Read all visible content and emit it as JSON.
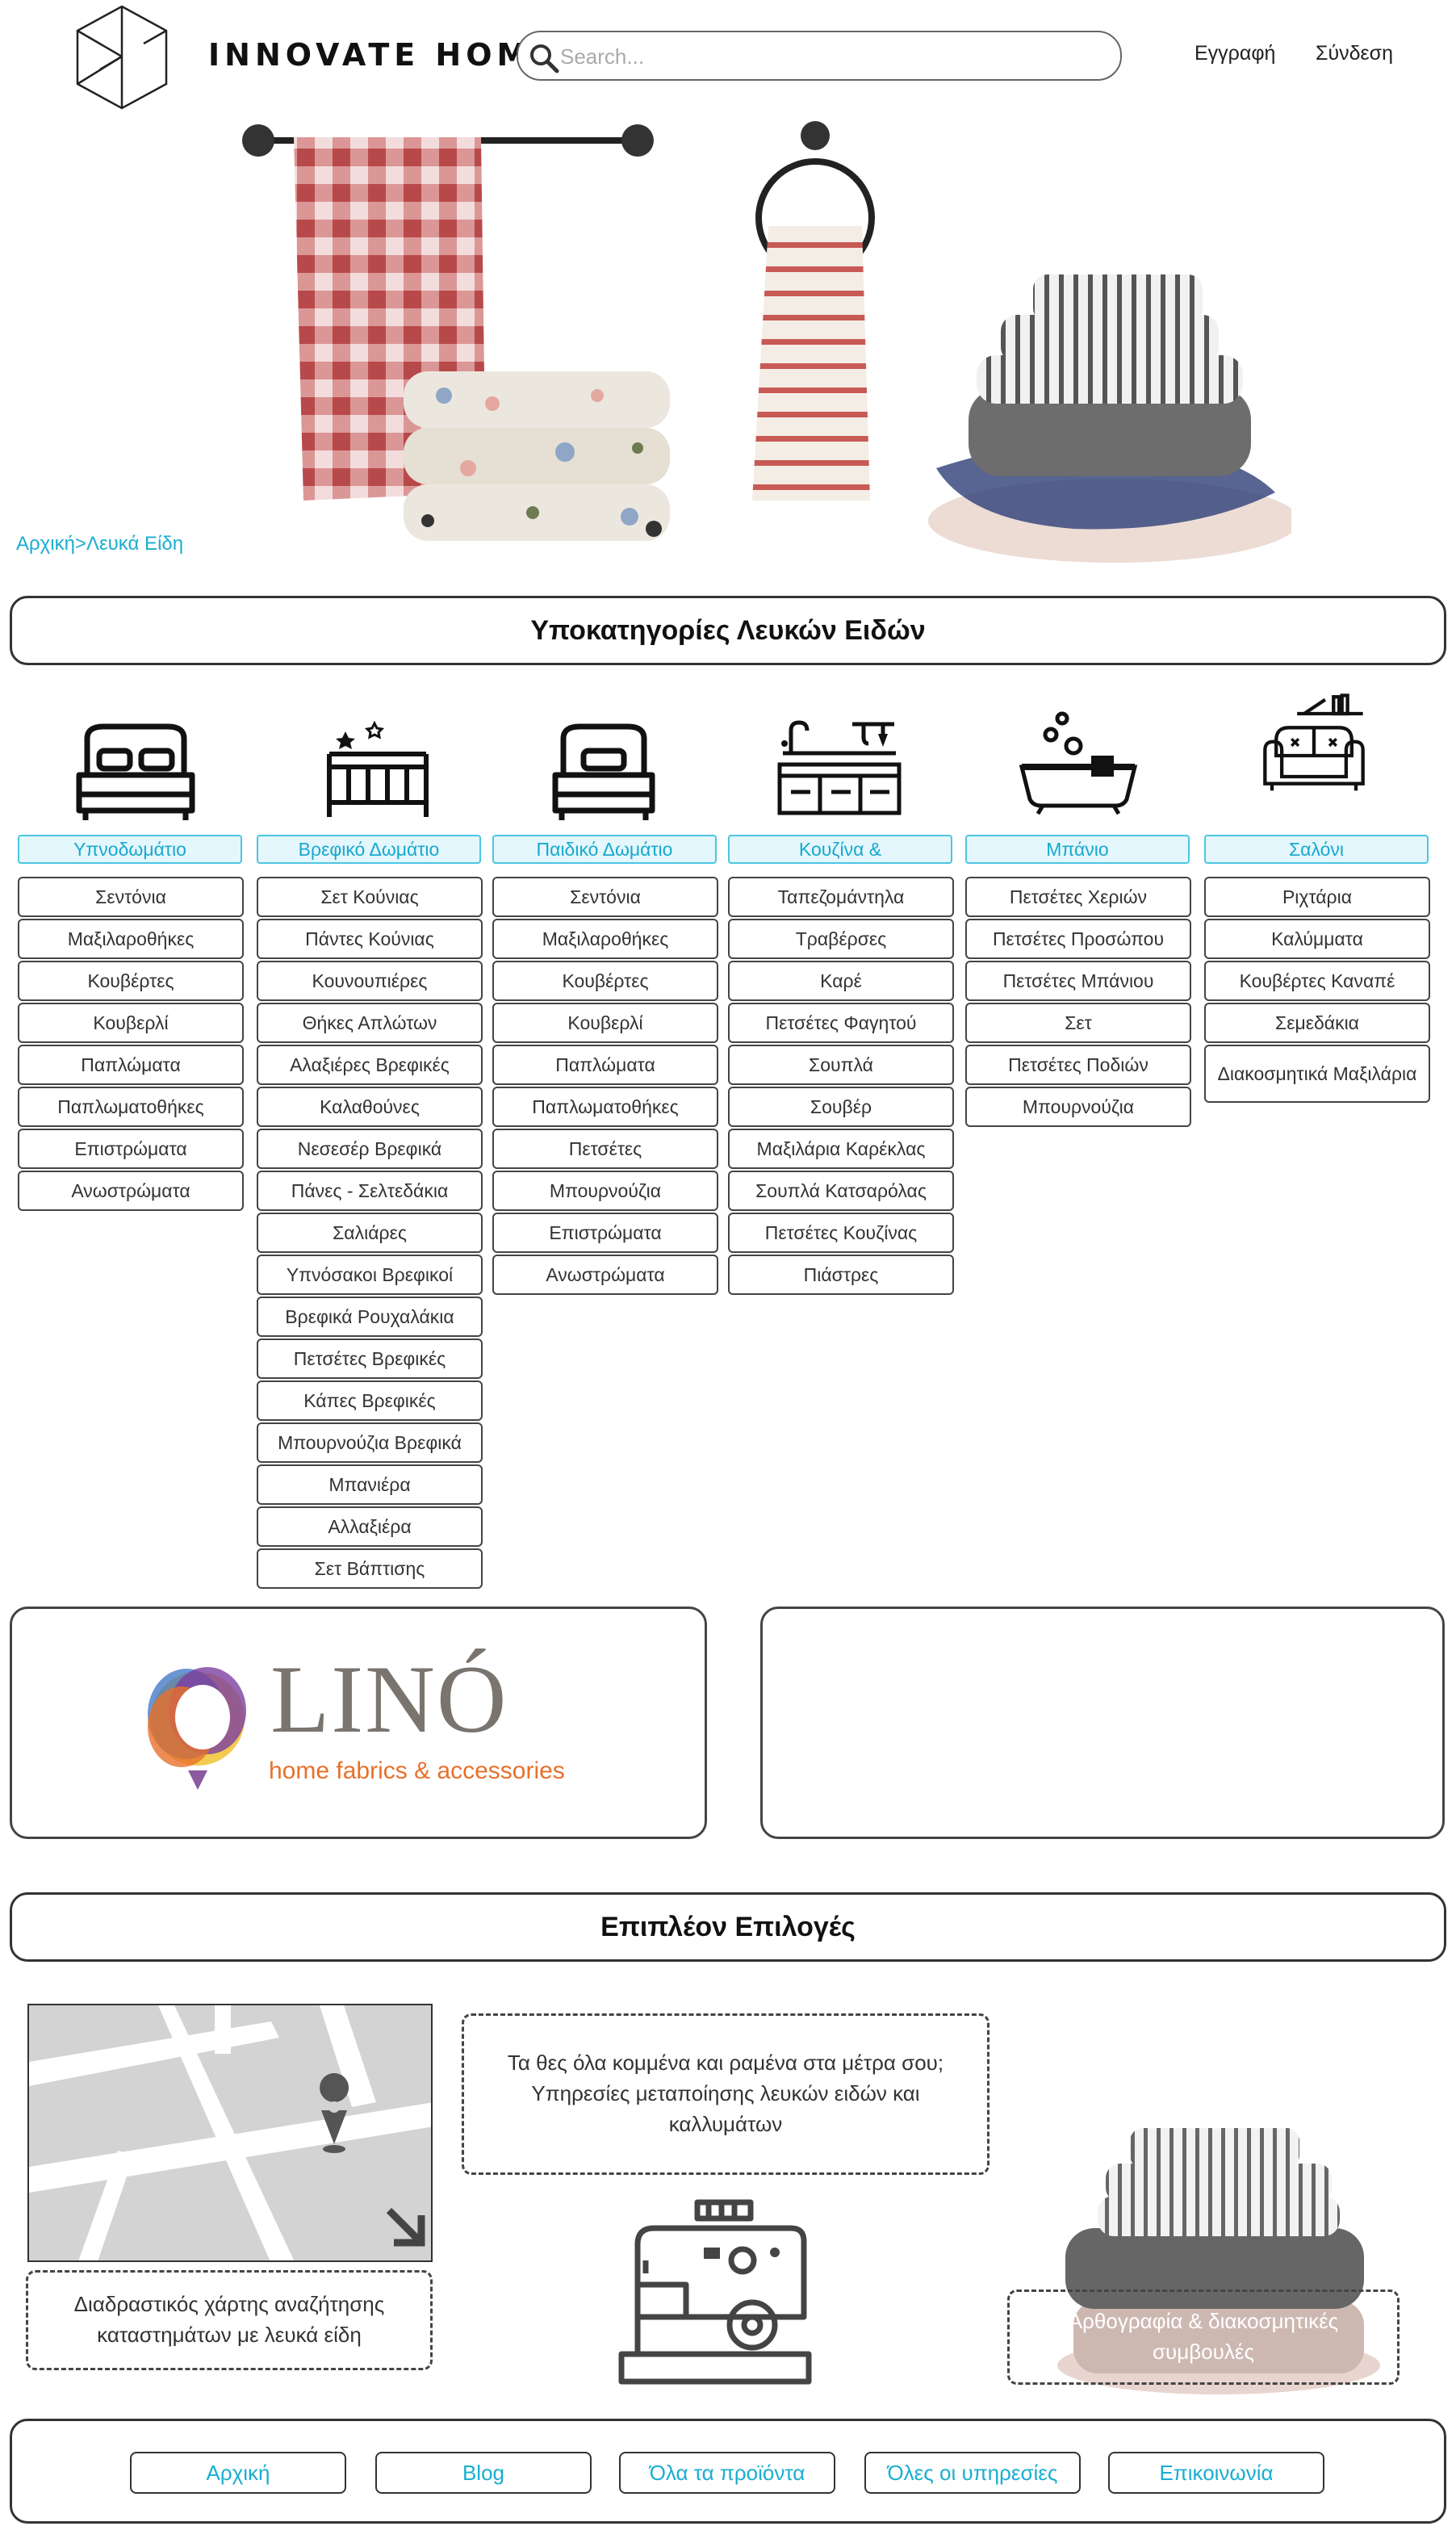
{
  "header": {
    "logo_text": "INNOVATE HOME",
    "search_placeholder": "Search...",
    "register_label": "Εγγραφή",
    "login_label": "Σύνδεση"
  },
  "breadcrumb": {
    "home": "Αρχική",
    "separator": ">",
    "current": "Λευκά Είδη"
  },
  "subcategories_title": "Υποκατηγορίες Λευκών Ειδών",
  "categories": [
    {
      "title": "Υπνοδωμάτιο",
      "icon": "bed-icon",
      "items": [
        "Σεντόνια",
        "Μαξιλαροθήκες",
        "Κουβέρτες",
        "Κουβερλί",
        "Παπλώματα",
        "Παπλωματοθήκες",
        "Επιστρώματα",
        "Ανωστρώματα"
      ]
    },
    {
      "title": "Βρεφικό Δωμάτιο",
      "icon": "crib-icon",
      "items": [
        "Σετ Κούνιας",
        "Πάντες Κούνιας",
        "Κουνουπιέρες",
        "Θήκες Απλώτων",
        "Αλαξιέρες Βρεφικές",
        "Καλαθούνες",
        "Νεσεσέρ Βρεφικά",
        "Πάνες - Σελτεδάκια",
        "Σαλιάρες",
        "Υπνόσακοι Βρεφικοί",
        "Βρεφικά Ρουχαλάκια",
        "Πετσέτες Βρεφικές",
        "Κάπες Βρεφικές",
        "Μπουρνούζια Βρεφικά",
        "Μπανιέρα",
        "Αλλαξιέρα",
        "Σετ Βάπτισης"
      ]
    },
    {
      "title": "Παιδικό Δωμάτιο",
      "icon": "single-bed-icon",
      "items": [
        "Σεντόνια",
        "Μαξιλαροθήκες",
        "Κουβέρτες",
        "Κουβερλί",
        "Παπλώματα",
        "Παπλωματοθήκες",
        "Πετσέτες",
        "Μπουρνούζια",
        "Επιστρώματα",
        "Ανωστρώματα"
      ]
    },
    {
      "title": "Κουζίνα &",
      "icon": "kitchen-icon",
      "items": [
        "Ταπεζομάντηλα",
        "Τραβέρσες",
        "Καρέ",
        "Πετσέτες Φαγητού",
        "Σουπλά",
        "Σουβέρ",
        "Μαξιλάρια Καρέκλας",
        "Σουπλά Κατσαρόλας",
        "Πετσέτες Κουζίνας",
        "Πιάστρες"
      ]
    },
    {
      "title": "Μπάνιο",
      "icon": "bathtub-icon",
      "items": [
        "Πετσέτες Χεριών",
        "Πετσέτες Προσώπου",
        "Πετσέτες Μπάνιου",
        "Σετ",
        "Πετσέτες Ποδιών",
        "Μπουρνούζια"
      ]
    },
    {
      "title": "Σαλόνι",
      "icon": "sofa-icon",
      "items": [
        "Ριχτάρια",
        "Καλύμματα",
        "Κουβέρτες Καναπέ",
        "Σεμεδάκια",
        "Διακοσμητικά Μαξιλάρια"
      ]
    }
  ],
  "partner": {
    "brand": "LINÓ",
    "tagline": "home fabrics & accessories",
    "colors": {
      "brand_gray": "#7a746e",
      "tagline": "#e8702a"
    }
  },
  "more_options_title": "Επιπλέον Επιλογές",
  "options": {
    "map_caption": "Διαδραστικός χάρτης αναζήτησης καταστημάτων με λευκά είδη",
    "tailoring_text": "Τα θες όλα κομμένα και ραμένα στα μέτρα σου; Υπηρεσίες μεταποίησης λευκών ειδών και καλλυμάτων",
    "articles_text": "Αρθογραφία & διακοσμητικές συμβουλές"
  },
  "footer": {
    "links": [
      "Αρχική",
      "Blog",
      "Όλα τα προϊόντα",
      "Όλες οι υπηρεσίες",
      "Επικοινωνία"
    ]
  },
  "colors": {
    "accent": "#16a9cf",
    "accent_bg": "#e4f7fc",
    "border": "#333333"
  }
}
